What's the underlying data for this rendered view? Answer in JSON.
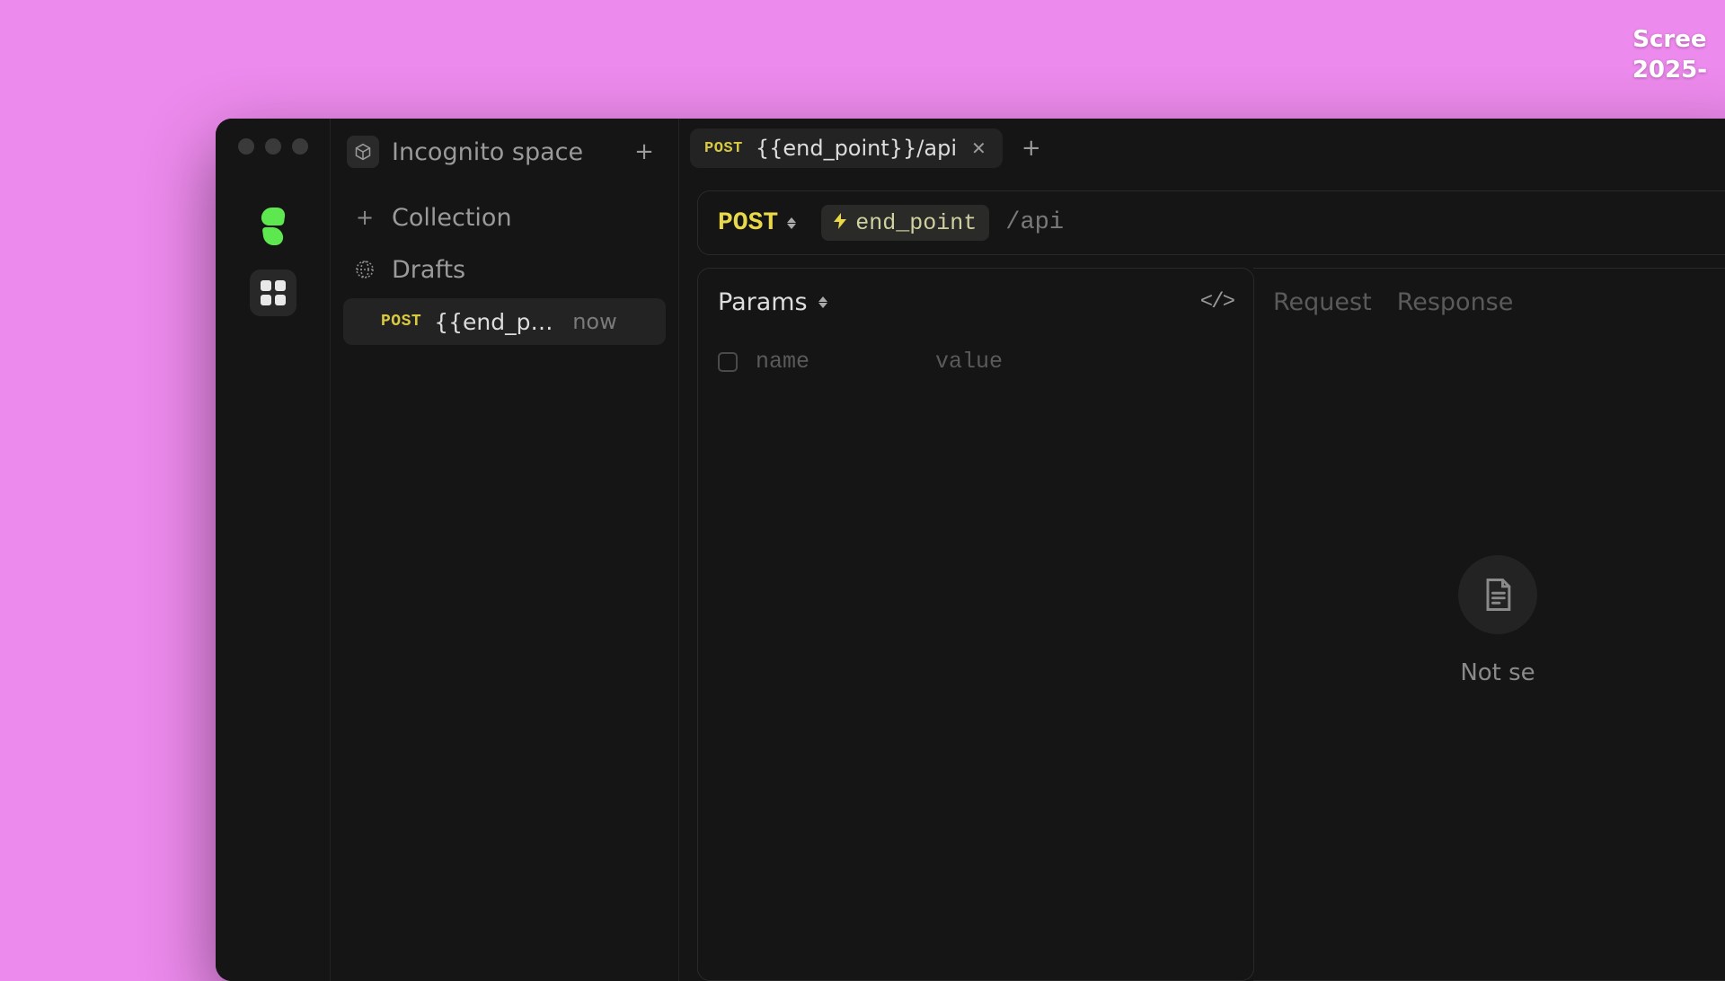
{
  "desktop": {
    "file_line1": "Scree",
    "file_line2": "2025-"
  },
  "workspace": {
    "name": "Incognito space"
  },
  "sidebar": {
    "collection_label": "Collection",
    "drafts_label": "Drafts",
    "draft_items": [
      {
        "method": "POST",
        "name": "{{end_po...",
        "time": "now"
      }
    ]
  },
  "tabs": [
    {
      "method": "POST",
      "title": "{{end_point}}/api"
    }
  ],
  "request": {
    "method": "POST",
    "variable": "end_point",
    "url_suffix": "/api"
  },
  "params": {
    "title": "Params",
    "name_placeholder": "name",
    "value_placeholder": "value"
  },
  "response": {
    "request_tab": "Request",
    "response_tab": "Response",
    "empty_text": "Not se"
  }
}
